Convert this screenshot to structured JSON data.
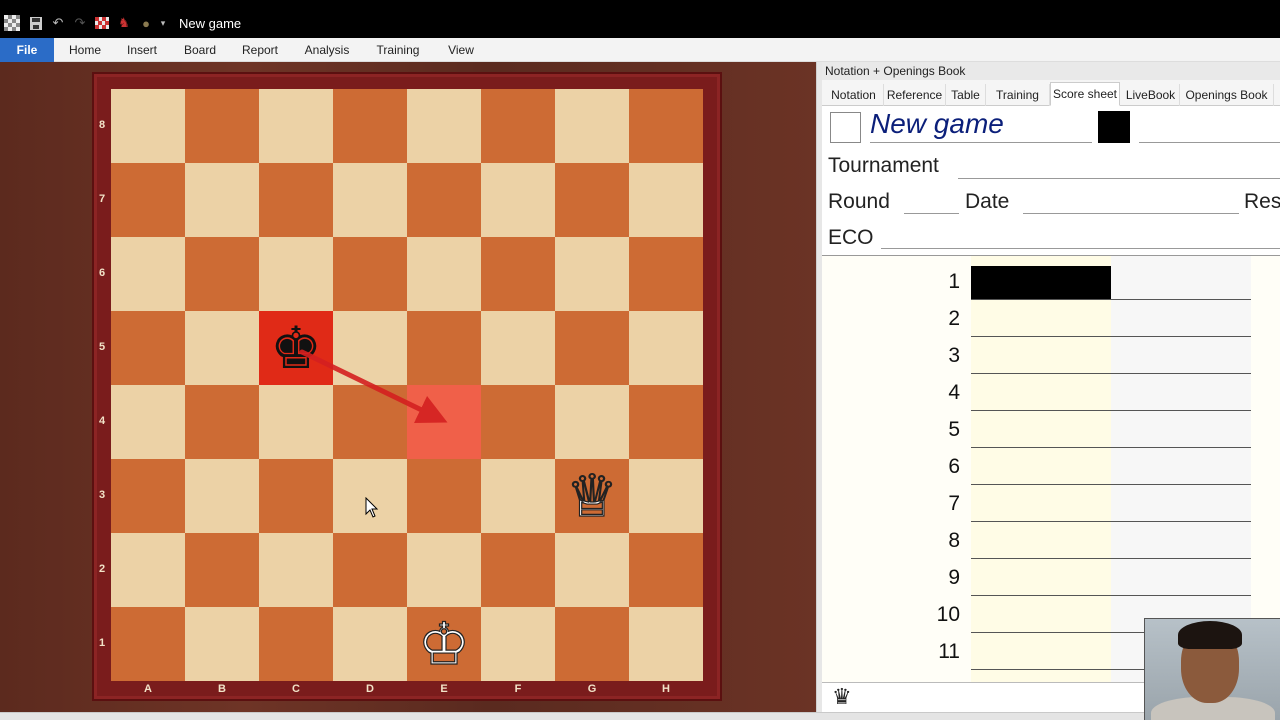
{
  "titlebar": {
    "title": "New game",
    "icons": [
      "app-logo-icon",
      "save-icon",
      "undo-icon",
      "redo-icon",
      "flag-icon",
      "figure-icon",
      "bulb-icon",
      "dropdown-icon"
    ]
  },
  "ribbon": {
    "tabs": [
      "File",
      "Home",
      "Insert",
      "Board",
      "Report",
      "Analysis",
      "Training",
      "View"
    ]
  },
  "board": {
    "ranks": [
      "8",
      "7",
      "6",
      "5",
      "4",
      "3",
      "2",
      "1"
    ],
    "files": [
      "A",
      "B",
      "C",
      "D",
      "E",
      "F",
      "G",
      "H"
    ],
    "pieces": [
      {
        "name": "black-king",
        "square": "c5",
        "glyph": "♚",
        "color": "black"
      },
      {
        "name": "white-queen",
        "square": "g3",
        "glyph": "♕",
        "color": "white"
      },
      {
        "name": "white-king",
        "square": "e1",
        "glyph": "♔",
        "color": "white"
      }
    ],
    "highlight_from": "c5",
    "highlight_to": "e4",
    "arrow": {
      "from": "c5",
      "to": "e4",
      "color": "#d42020"
    },
    "colors": {
      "light": "#ecd2a6",
      "dark": "#cd6b34",
      "frame": "#7a1c1c"
    }
  },
  "pane": {
    "header": "Notation + Openings Book",
    "tabs": [
      "Notation",
      "Reference",
      "Table",
      "Training",
      "Score sheet",
      "LiveBook",
      "Openings Book"
    ],
    "active_tab": "Score sheet"
  },
  "scoresheet": {
    "game_name": "New game",
    "labels": {
      "tournament": "Tournament",
      "round": "Round",
      "date": "Date",
      "result": "Resu",
      "eco": "ECO"
    },
    "move_numbers": [
      "1",
      "2",
      "3",
      "4",
      "5",
      "6",
      "7",
      "8",
      "9",
      "10",
      "11"
    ]
  },
  "footer": {
    "icon": "queen-icon",
    "glyph": "♛"
  }
}
